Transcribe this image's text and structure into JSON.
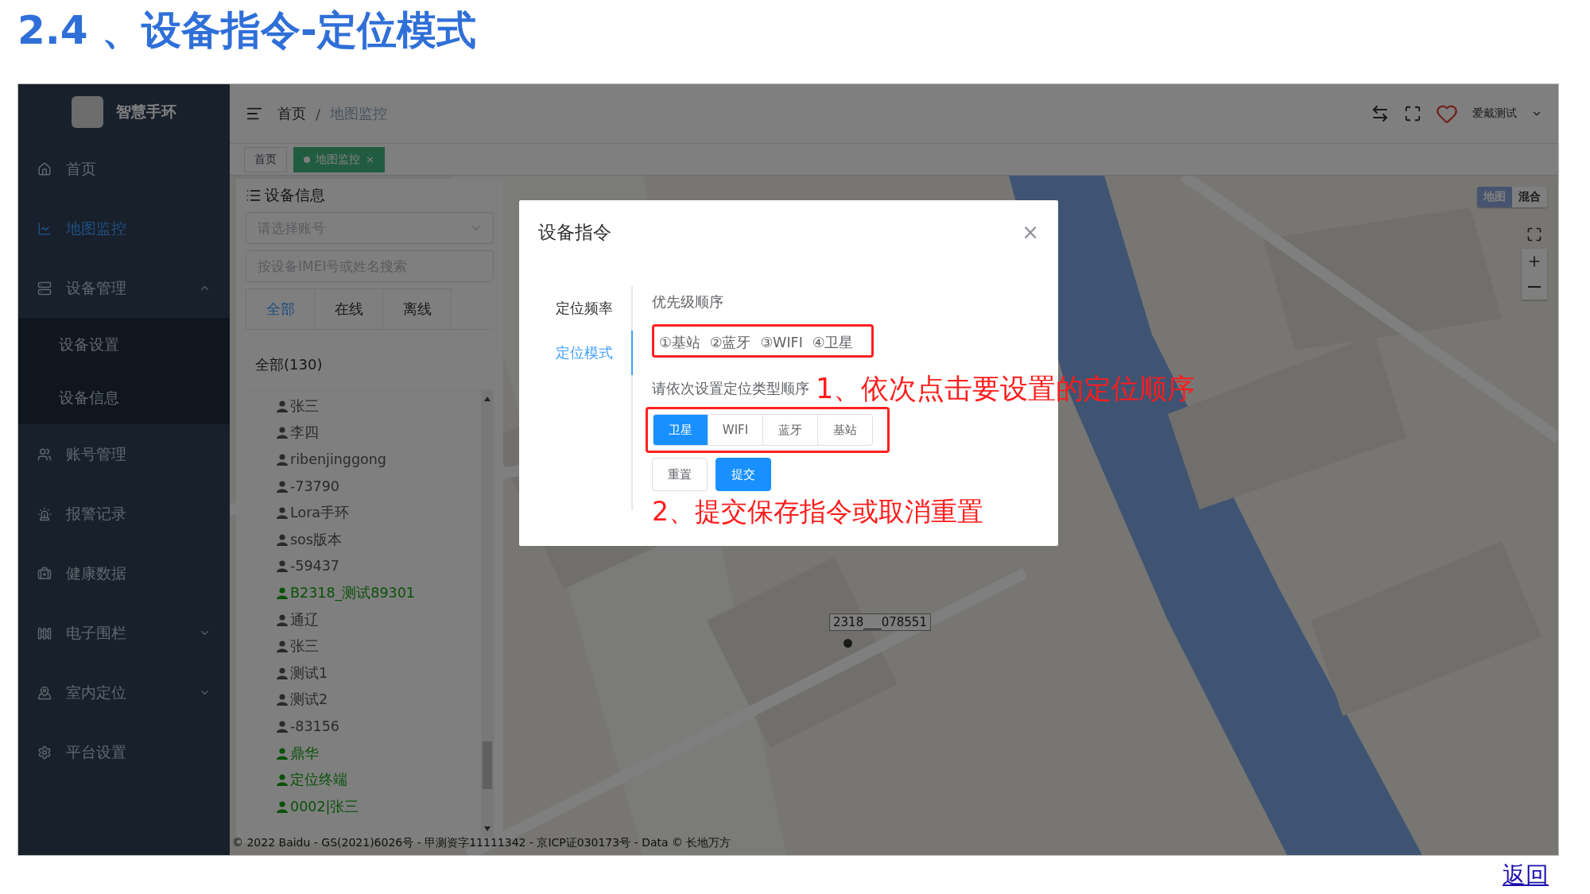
{
  "title": "2.4 、设备指令-定位模式",
  "app": {
    "logo": "智慧手环",
    "sidebar": [
      {
        "label": "首页",
        "selected": false
      },
      {
        "label": "地图监控",
        "selected": true
      },
      {
        "label": "设备管理",
        "selected": false,
        "expanded": true,
        "children": [
          {
            "label": "设备设置"
          },
          {
            "label": "设备信息"
          }
        ]
      },
      {
        "label": "账号管理",
        "selected": false
      },
      {
        "label": "报警记录",
        "selected": false
      },
      {
        "label": "健康数据",
        "selected": false
      },
      {
        "label": "电子围栏",
        "selected": false,
        "expanded": false
      },
      {
        "label": "室内定位",
        "selected": false,
        "expanded": false
      },
      {
        "label": "平台设置",
        "selected": false
      }
    ],
    "header": {
      "breadcrumb": [
        "首页",
        "地图监控"
      ],
      "separator": "/",
      "user": "爱戴测试"
    },
    "tags": [
      {
        "label": "首页",
        "selected": false
      },
      {
        "label": "地图监控",
        "selected": true,
        "close": "×"
      }
    ],
    "panel": {
      "title": "设备信息",
      "account_placeholder": "请选择账号",
      "search_placeholder": "按设备IMEI号或姓名搜索",
      "tabs": [
        {
          "label": "全部",
          "selected": true
        },
        {
          "label": "在线",
          "selected": false
        },
        {
          "label": "离线",
          "selected": false
        }
      ],
      "group": "全部(130)",
      "devices": [
        {
          "name": "张三",
          "online": false
        },
        {
          "name": "李四",
          "online": false
        },
        {
          "name": "ribenjinggong",
          "online": false
        },
        {
          "name": "-73790",
          "online": false
        },
        {
          "name": "Lora手环",
          "online": false
        },
        {
          "name": "sos版本",
          "online": false
        },
        {
          "name": "-59437",
          "online": false
        },
        {
          "name": "B2318_测试89301",
          "online": true
        },
        {
          "name": "通辽",
          "online": false
        },
        {
          "name": "张三",
          "online": false
        },
        {
          "name": "测试1",
          "online": false
        },
        {
          "name": "测试2",
          "online": false
        },
        {
          "name": "-83156",
          "online": false
        },
        {
          "name": "鼎华",
          "online": true
        },
        {
          "name": "定位终端",
          "online": true
        },
        {
          "name": "0002|张三",
          "online": true
        }
      ]
    },
    "map": {
      "layers": [
        {
          "label": "地图",
          "selected": true
        },
        {
          "label": "混合",
          "selected": false
        }
      ],
      "marker_label": "2318___078551",
      "copyright": "© 2022 Baidu - GS(2021)6026号 - 甲测资字11111342 - 京ICP证030173号 - Data © 长地万方"
    }
  },
  "dialog": {
    "title": "设备指令",
    "close": "×",
    "side_tabs": [
      {
        "label": "定位频率",
        "selected": false
      },
      {
        "label": "定位模式",
        "selected": true
      }
    ],
    "priority_label": "优先级顺序",
    "priority": [
      "①基站",
      "②蓝牙",
      "③WIFI",
      "④卫星"
    ],
    "prompt": "请依次设置定位类型顺序",
    "options": [
      {
        "label": "卫星",
        "selected": true
      },
      {
        "label": "WIFI",
        "selected": false
      },
      {
        "label": "蓝牙",
        "selected": false
      },
      {
        "label": "基站",
        "selected": false
      }
    ],
    "buttons": [
      {
        "label": "重置",
        "kind": "default"
      },
      {
        "label": "提交",
        "kind": "primary"
      }
    ]
  },
  "annotations": [
    "1、依次点击要设置的定位顺序",
    "2、提交保存指令或取消重置"
  ],
  "back_link": "返回"
}
